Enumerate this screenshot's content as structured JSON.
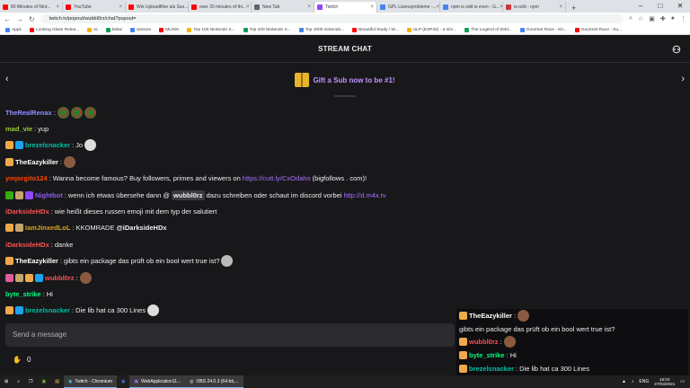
{
  "browser": {
    "tabs": [
      {
        "label": "80 Minutes of Nint...",
        "color": "#ff0000"
      },
      {
        "label": "YouTube",
        "color": "#ff0000"
      },
      {
        "label": "Wie Uploadfilter als Sus...",
        "color": "#ff0000"
      },
      {
        "label": "over 20 minutes of thi...",
        "color": "#ff0000"
      },
      {
        "label": "New Tab",
        "color": "#5f6368"
      },
      {
        "label": "Twitch",
        "color": "#9146ff",
        "active": true
      },
      {
        "label": "GPL Lizenzprobleme -...",
        "color": "#4285f4"
      },
      {
        "label": "npm is odd is even - G...",
        "color": "#4285f4"
      },
      {
        "label": "is-odd - npm",
        "color": "#cb3837"
      }
    ],
    "url": "twitch.tv/popout/wubbl0rz/chat?popout=",
    "bookmarks": [
      "Apps",
      "Looking Glass Relea...",
      "sc",
      "kekw",
      "session",
      "MUSIK",
      "Top 100 Nintendo S...",
      "Top 100 Nintendo S...",
      "Top 1000 nintendo...",
      "Beautiful Study / W...",
      "ULP (ESP32) - a sim...",
      "The Legend of Zeld...",
      "Gourmet Race - Kir...",
      "Gourmet Race - Su..."
    ]
  },
  "chat": {
    "header": "STREAM CHAT",
    "gift_banner": "Gift a Sub now to be #1!",
    "messages": [
      {
        "badges": [],
        "user": "TheRealRenax",
        "color": "#8f8fff",
        "text": "",
        "emotes": [
          "xmas",
          "xmas",
          "xmas"
        ]
      },
      {
        "badges": [],
        "user": "mad_vie",
        "color": "#9acd32",
        "text": "yup",
        "emotes": []
      },
      {
        "badges": [
          "tier",
          "prime"
        ],
        "user": "brezelsnacker",
        "color": "#00c0a8",
        "text": "Jo",
        "emotes": [
          "face"
        ]
      },
      {
        "badges": [
          "tier"
        ],
        "user": "TheEazykiller",
        "color": "#ffffff",
        "text": "",
        "emotes": [
          "man"
        ]
      },
      {
        "badges": [],
        "user": "ymjorgito124",
        "color": "#ff4500",
        "text": "Wanna become famous? Buy followers, primes and viewers on",
        "link": "https://cutt.ly/CxOdaho",
        "after": "(bigfollows . com)!"
      },
      {
        "badges": [
          "mod",
          "gift",
          "sub"
        ],
        "user": "Nightbot",
        "color": "#8a5cf5",
        "text": "wenn ich etwas übersehe dann @",
        "mention": "wubbl0rz",
        "after": "dazu schreiben oder schaut im discord vorbei",
        "link": "http://d.m4x.tv"
      },
      {
        "badges": [],
        "user": "iDarksideHDx",
        "color": "#ff4f4f",
        "text": "wie heißt dieses russen emoji mit dem typ der salutiert",
        "emotes": []
      },
      {
        "badges": [
          "tier",
          "gift"
        ],
        "user": "IamJinxedLoL",
        "color": "#daa520",
        "text": "KKOMRADE",
        "mention_plain": "@iDarksideHDx"
      },
      {
        "badges": [],
        "user": "iDarksideHDx",
        "color": "#ff4f4f",
        "text": "danke",
        "emotes": []
      },
      {
        "badges": [
          "tier"
        ],
        "user": "TheEazykiller",
        "color": "#ffffff",
        "text": "gibts ein package das prüft ob ein bool wert true ist?",
        "emotes": [
          "bw"
        ]
      },
      {
        "badges": [
          "vip",
          "gift",
          "tier",
          "prime"
        ],
        "user": "wubbl0rz",
        "color": "#ff4f4f",
        "text": "",
        "emotes": [
          "man"
        ]
      },
      {
        "badges": [],
        "user": "byte_strike",
        "color": "#00ff7f",
        "text": "Hi",
        "emotes": []
      },
      {
        "badges": [
          "tier",
          "prime"
        ],
        "user": "brezelsnacker",
        "color": "#00c0a8",
        "text": "Die lib hat ca 300 Lines",
        "emotes": [
          "face"
        ]
      }
    ],
    "input_placeholder": "Send a message",
    "points": "0",
    "overlay": [
      {
        "user": "TheEazykiller",
        "color": "#ffffff",
        "text": ""
      },
      {
        "user": "",
        "color": "#ffffff",
        "text": "gibts ein package das prüft ob ein bool wert true ist?"
      },
      {
        "user": "wubbl0rz",
        "color": "#ff4f4f",
        "text": ""
      },
      {
        "user": "byte_strike",
        "color": "#00ff7f",
        "text": "Hi"
      },
      {
        "user": "brezelsnacker",
        "color": "#00c0a8",
        "text": "Die lib hat ca 300 Lines"
      }
    ]
  },
  "taskbar": {
    "apps": [
      "Twitch - Chromium",
      "WebApplication11...",
      "OBS 24.0.3 (64-bit,..."
    ],
    "lang": "ENG",
    "time": "16:02",
    "date": "27/03/2021"
  }
}
